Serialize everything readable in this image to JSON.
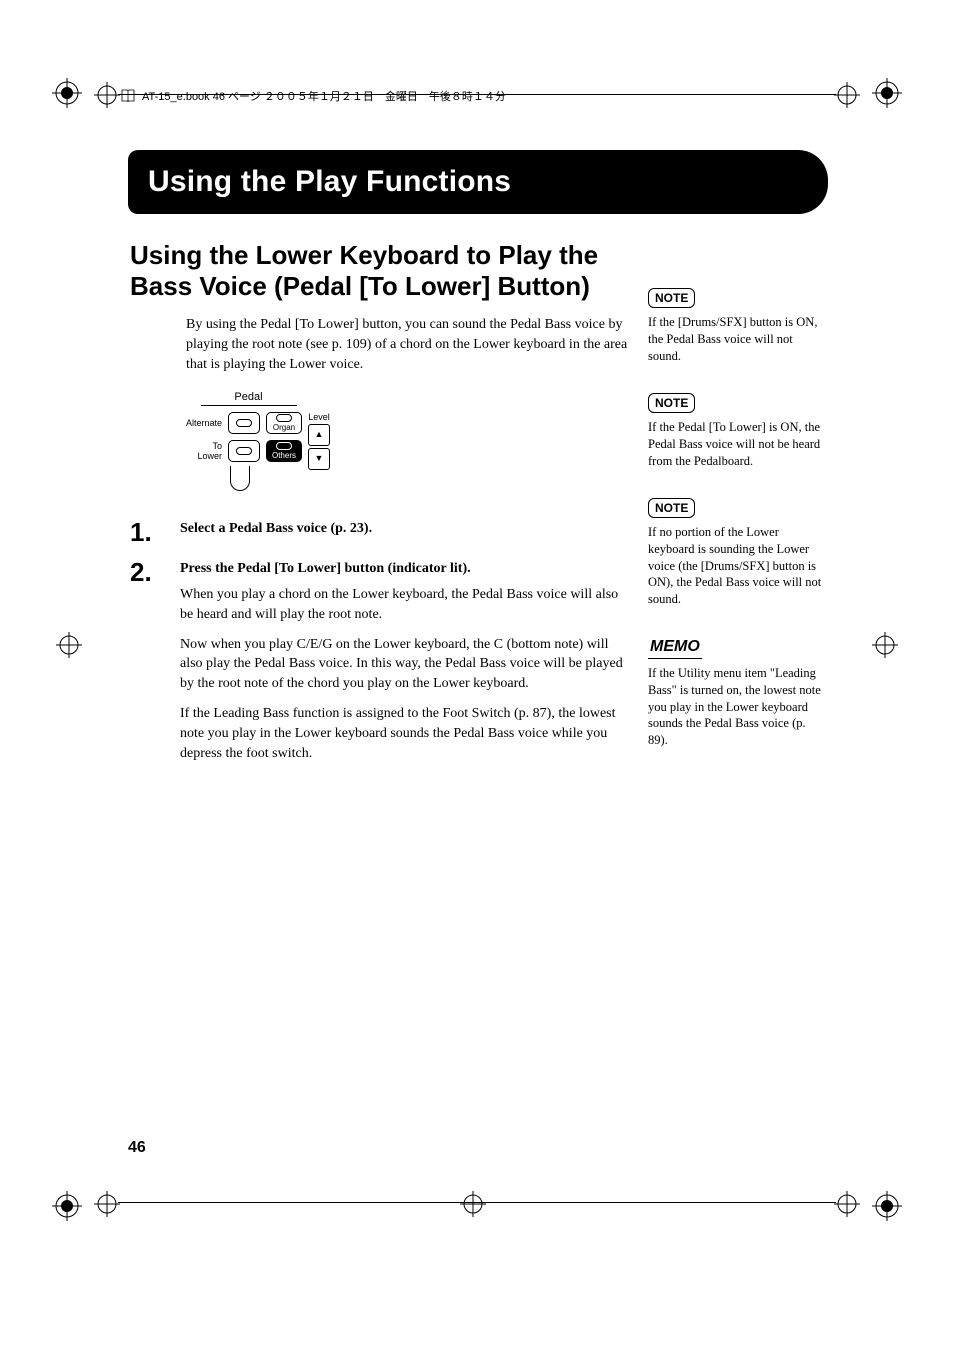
{
  "header": {
    "book_info": "AT-15_e.book  46 ページ  ２００５年１月２１日　金曜日　午後８時１４分"
  },
  "banner": {
    "title": "Using the Play Functions"
  },
  "section": {
    "title": "Using the Lower Keyboard to Play the Bass Voice (Pedal [To Lower] Button)",
    "intro": "By using the Pedal [To Lower] button, you can sound the Pedal Bass voice by playing the root note (see p. 109) of a chord on the Lower keyboard in the area that is playing the Lower voice."
  },
  "diagram": {
    "header": "Pedal",
    "alternate": "Alternate",
    "to_lower": "To Lower",
    "organ": "Organ",
    "others": "Others",
    "level": "Level"
  },
  "steps": [
    {
      "num": "1.",
      "heading": "Select a Pedal Bass voice (p. 23).",
      "paras": []
    },
    {
      "num": "2.",
      "heading": "Press the Pedal [To Lower] button (indicator lit).",
      "paras": [
        "When you play a chord on the Lower keyboard, the Pedal Bass voice will also be heard and will play the root note.",
        "Now when you play C/E/G on the Lower keyboard, the C (bottom note) will also play the Pedal Bass voice. In this way, the Pedal Bass voice will be played by the root note of the chord you play on the Lower keyboard.",
        "If the Leading Bass function is assigned to the Foot Switch (p. 87), the lowest note you play in the Lower keyboard sounds the Pedal Bass voice while you depress the foot switch."
      ]
    }
  ],
  "sidenotes": [
    {
      "kind": "note",
      "label": "NOTE",
      "text": "If the [Drums/SFX] button is ON, the Pedal Bass voice will not sound."
    },
    {
      "kind": "note",
      "label": "NOTE",
      "text": "If the Pedal [To Lower] is ON, the Pedal Bass voice will not be heard from the Pedalboard."
    },
    {
      "kind": "note",
      "label": "NOTE",
      "text": "If no portion of the Lower keyboard is sounding the Lower voice (the [Drums/SFX] button is ON), the Pedal Bass voice will not sound."
    },
    {
      "kind": "memo",
      "label": "MEMO",
      "text": "If the Utility menu item \"Leading Bass\" is turned on, the lowest note you play in the Lower keyboard sounds the Pedal Bass voice (p. 89)."
    }
  ],
  "page_number": "46"
}
